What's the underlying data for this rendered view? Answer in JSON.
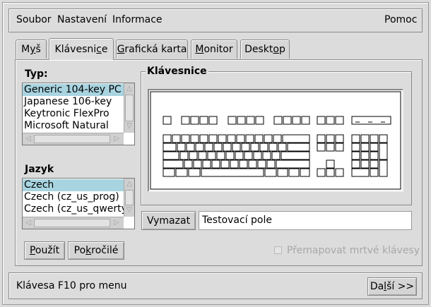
{
  "menubar": {
    "items": [
      "Soubor",
      "Nastavení",
      "Informace"
    ],
    "help": "Pomoc"
  },
  "tabs": [
    {
      "pre": "M",
      "ul": "y",
      "post": "š",
      "active": false
    },
    {
      "pre": "Klávesni",
      "ul": "c",
      "post": "e",
      "active": true
    },
    {
      "pre": "",
      "ul": "G",
      "post": "rafická karta",
      "active": false
    },
    {
      "pre": "",
      "ul": "M",
      "post": "onitor",
      "active": false
    },
    {
      "pre": "Deskt",
      "ul": "o",
      "post": "p",
      "active": false
    }
  ],
  "type_section": {
    "label": "Typ:",
    "items": [
      "Generic 104-key PC",
      "Japanese 106-key",
      "Keytronic FlexPro",
      "Microsoft Natural"
    ],
    "selected": 0
  },
  "lang_section": {
    "label": "Jazyk",
    "items": [
      "Czech",
      "Czech (cz_us_prog)",
      "Czech (cz_us_qwerty)"
    ],
    "selected": 0
  },
  "keyboard_group": {
    "title": "Klávesnice"
  },
  "test": {
    "clear_button": "Vymazat",
    "field_value": "Testovací pole"
  },
  "actions": {
    "apply": {
      "pre": "",
      "ul": "P",
      "post": "oužít"
    },
    "advanced": {
      "pre": "Po",
      "ul": "k",
      "post": "ročilé"
    },
    "remap_dead_keys": "Přemapovat mrtvé klávesy",
    "remap_checked": false
  },
  "footer": {
    "hint": "Klávesa F10 pro menu",
    "next": {
      "pre": "Da",
      "ul": "l",
      "post": "ší >>"
    }
  }
}
